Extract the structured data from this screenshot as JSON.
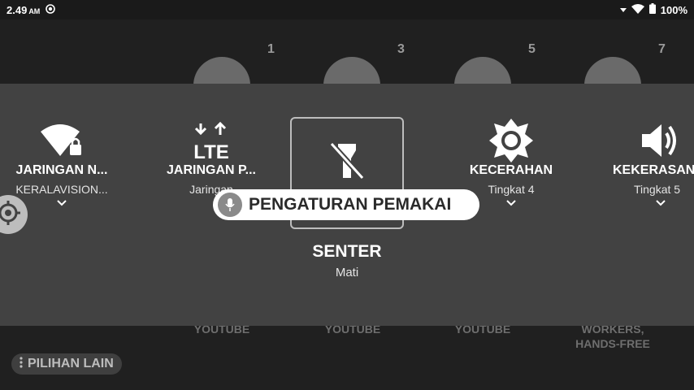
{
  "status_bar": {
    "time": "2.49",
    "ampm": "AM",
    "battery": "100%"
  },
  "background": {
    "numbers": [
      "1",
      "3",
      "5",
      "7"
    ],
    "labels": [
      "YOUTUBE",
      "YOUTUBE",
      "YOUTUBE",
      "WORKERS,",
      "HANDS-FREE"
    ],
    "more_button": "PILIHAN LAIN"
  },
  "quick_settings": {
    "tiles": [
      {
        "title": "JARINGAN N...",
        "subtitle": "KERALAVISION...",
        "icon": "wifi-lock-icon"
      },
      {
        "title": "JARINGAN P...",
        "subtitle": "Jaringan",
        "icon": "lte-icon"
      },
      {
        "title": "SENTER",
        "subtitle": "Mati",
        "icon": "flashlight-off-icon"
      },
      {
        "title": "KECERAHAN",
        "subtitle": "Tingkat 4",
        "icon": "brightness-icon"
      },
      {
        "title": "KEKERASAN",
        "subtitle": "Tingkat 5",
        "icon": "volume-icon"
      }
    ]
  },
  "voice_hint": {
    "label": "PENGATURAN PEMAKAI",
    "icon": "mic-icon"
  },
  "accessibility": {
    "icon": "target-icon"
  }
}
